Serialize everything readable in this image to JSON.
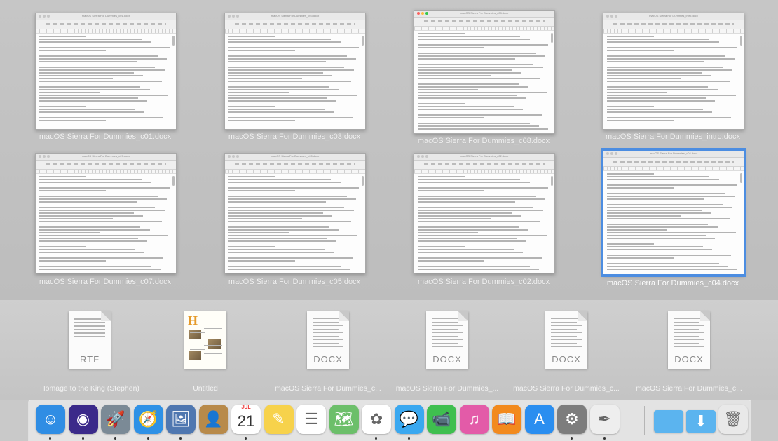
{
  "windows": [
    {
      "label": "macOS Sierra For Dummies_c01.docx",
      "title": "macOS Sierra For Dummies_c01.docx",
      "active": false,
      "selected": false
    },
    {
      "label": "macOS Sierra For Dummies_c03.docx",
      "title": "macOS Sierra For Dummies_c03.docx",
      "active": false,
      "selected": false
    },
    {
      "label": "macOS Sierra For Dummies_c08.docx",
      "title": "macOS Sierra For Dummies_c08.docx",
      "active": true,
      "selected": false
    },
    {
      "label": "macOS Sierra For Dummies_intro.docx",
      "title": "macOS Sierra For Dummies_intro.docx",
      "active": false,
      "selected": false
    },
    {
      "label": "macOS Sierra For Dummies_c07.docx",
      "title": "macOS Sierra For Dummies_c07.docx",
      "active": false,
      "selected": false
    },
    {
      "label": "macOS Sierra For Dummies_c05.docx",
      "title": "macOS Sierra For Dummies_c05.docx",
      "active": false,
      "selected": false
    },
    {
      "label": "macOS Sierra For Dummies_c02.docx",
      "title": "macOS Sierra For Dummies_c02.docx",
      "active": false,
      "selected": false
    },
    {
      "label": "macOS Sierra For Dummies_c04.docx",
      "title": "macOS Sierra For Dummies_c04.docx",
      "active": false,
      "selected": true
    }
  ],
  "desktop_files": [
    {
      "label": "Homage to the King (Stephen)",
      "ext": "RTF",
      "kind": "lines"
    },
    {
      "label": "Untitled",
      "ext": "",
      "kind": "page"
    },
    {
      "label": "macOS Sierra For Dummies_c...",
      "ext": "DOCX",
      "kind": "doc"
    },
    {
      "label": "macOS Sierra For Dummies_...",
      "ext": "DOCX",
      "kind": "doc"
    },
    {
      "label": "macOS Sierra For Dummies_c...",
      "ext": "DOCX",
      "kind": "doc"
    },
    {
      "label": "macOS Sierra For Dummies_c...",
      "ext": "DOCX",
      "kind": "doc"
    }
  ],
  "dock": {
    "calendar_month": "JUL",
    "calendar_day": "21",
    "apps": [
      {
        "name": "finder-icon",
        "glyph": "☺",
        "color": "#2f8de4"
      },
      {
        "name": "siri-icon",
        "glyph": "◉",
        "color": "#3b2a8a"
      },
      {
        "name": "launchpad-icon",
        "glyph": "🚀",
        "color": "#7b8a96"
      },
      {
        "name": "safari-icon",
        "glyph": "🧭",
        "color": "#2e91e6"
      },
      {
        "name": "preview-icon",
        "glyph": "🖼",
        "color": "#4f77b0"
      },
      {
        "name": "contacts-icon",
        "glyph": "👤",
        "color": "#b88a4a"
      },
      {
        "name": "calendar-icon",
        "glyph": "",
        "color": "#ffffff"
      },
      {
        "name": "notes-icon",
        "glyph": "✎",
        "color": "#f7d24b"
      },
      {
        "name": "reminders-icon",
        "glyph": "☰",
        "color": "#ffffff"
      },
      {
        "name": "maps-icon",
        "glyph": "🗺",
        "color": "#6cbf6a"
      },
      {
        "name": "photos-icon",
        "glyph": "✿",
        "color": "#ffffff"
      },
      {
        "name": "messages-icon",
        "glyph": "💬",
        "color": "#3aa8f0"
      },
      {
        "name": "facetime-icon",
        "glyph": "📹",
        "color": "#3fbf4f"
      },
      {
        "name": "itunes-icon",
        "glyph": "♫",
        "color": "#e35ba8"
      },
      {
        "name": "ibooks-icon",
        "glyph": "📖",
        "color": "#f28a1e"
      },
      {
        "name": "app-store-icon",
        "glyph": "A",
        "color": "#2a8ef0"
      },
      {
        "name": "system-preferences-icon",
        "glyph": "⚙",
        "color": "#7d7d7d"
      },
      {
        "name": "textedit-icon",
        "glyph": "✒",
        "color": "#eeeeee"
      },
      {
        "name": "folder-icon",
        "glyph": "",
        "color": "#5bb4ef"
      },
      {
        "name": "downloads-folder-icon",
        "glyph": "⬇",
        "color": "#5bb4ef"
      },
      {
        "name": "trash-icon",
        "glyph": "🗑",
        "color": "#e9e9e9"
      }
    ]
  }
}
